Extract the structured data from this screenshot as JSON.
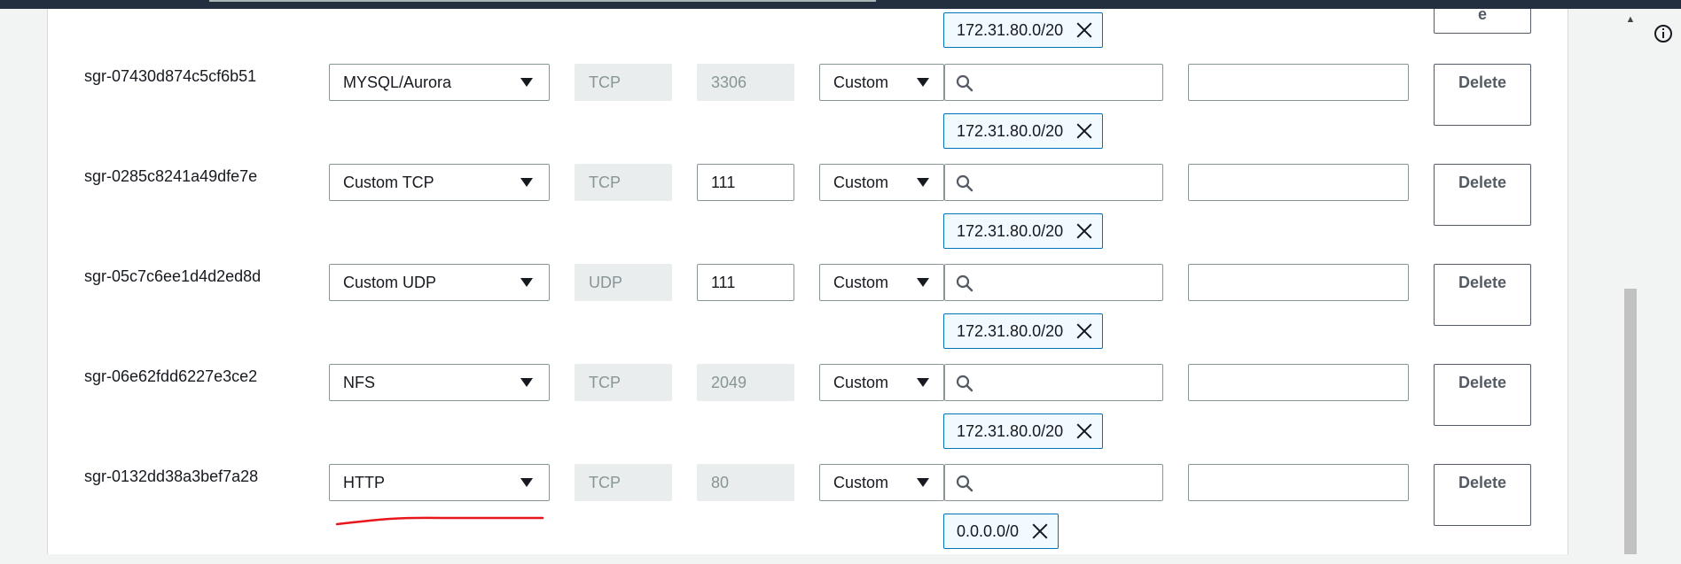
{
  "top_partial": {
    "token": "172.31.80.0/20",
    "delete_fragment": "e"
  },
  "rows": [
    {
      "id": "sgr-07430d874c5cf6b51",
      "type": "MYSQL/Aurora",
      "protocol": "TCP",
      "port": "3306",
      "port_editable": false,
      "source": "Custom",
      "token": "172.31.80.0/20",
      "delete_label": "Delete"
    },
    {
      "id": "sgr-0285c8241a49dfe7e",
      "type": "Custom TCP",
      "protocol": "TCP",
      "port": "111",
      "port_editable": true,
      "source": "Custom",
      "token": "172.31.80.0/20",
      "delete_label": "Delete"
    },
    {
      "id": "sgr-05c7c6ee1d4d2ed8d",
      "type": "Custom UDP",
      "protocol": "UDP",
      "port": "111",
      "port_editable": true,
      "source": "Custom",
      "token": "172.31.80.0/20",
      "delete_label": "Delete"
    },
    {
      "id": "sgr-06e62fdd6227e3ce2",
      "type": "NFS",
      "protocol": "TCP",
      "port": "2049",
      "port_editable": false,
      "source": "Custom",
      "token": "172.31.80.0/20",
      "delete_label": "Delete"
    },
    {
      "id": "sgr-0132dd38a3bef7a28",
      "type": "HTTP",
      "protocol": "TCP",
      "port": "80",
      "port_editable": false,
      "source": "Custom",
      "token": "0.0.0.0/0",
      "delete_label": "Delete"
    }
  ],
  "icons": {
    "search": "search-icon",
    "remove": "close-icon",
    "dropdown": "caret-down-icon",
    "info": "info-icon"
  },
  "colors": {
    "token_border": "#0073bb",
    "token_bg": "#f1faff",
    "annotation": "#e8161b"
  }
}
